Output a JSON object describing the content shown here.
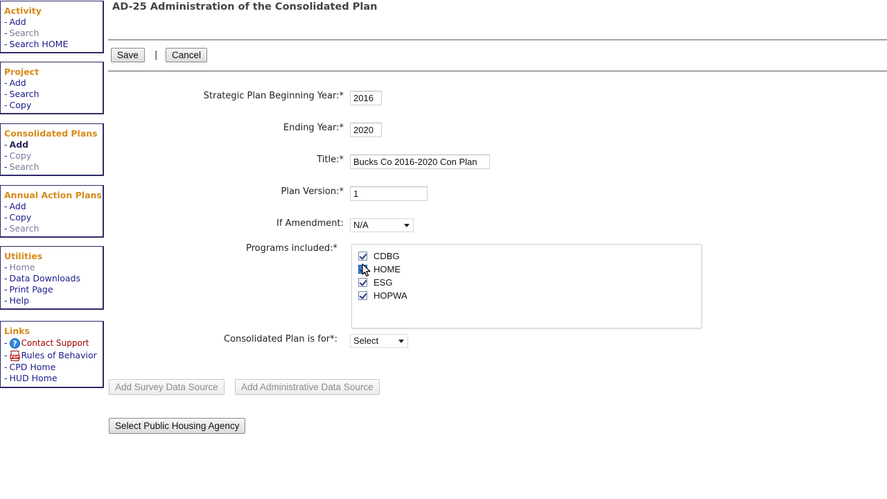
{
  "sidebar": {
    "activity": {
      "heading": "Activity",
      "items": [
        "Add",
        "Search",
        "Search HOME"
      ]
    },
    "project": {
      "heading": "Project",
      "items": [
        "Add",
        "Search",
        "Copy"
      ]
    },
    "consolidated": {
      "heading": "Consolidated Plans",
      "items": [
        "Add",
        "Copy",
        "Search"
      ]
    },
    "annual": {
      "heading": "Annual Action Plans",
      "items": [
        "Add",
        "Copy",
        "Search"
      ]
    },
    "utilities": {
      "heading": "Utilities",
      "items": [
        "Home",
        "Data Downloads",
        "Print Page",
        "Help"
      ]
    },
    "links": {
      "heading": "Links",
      "items": [
        "Contact Support",
        "Rules of Behavior",
        "CPD Home",
        "HUD Home"
      ],
      "icons": [
        "help-circle-icon",
        "pdf-icon"
      ]
    },
    "dash": "-"
  },
  "page": {
    "title": "AD-25 Administration of the Consolidated Plan"
  },
  "toolbar": {
    "save_label": "Save",
    "separator": "|",
    "cancel_label": "Cancel"
  },
  "form": {
    "begin_year": {
      "label": "Strategic Plan Beginning Year:*",
      "value": "2016"
    },
    "end_year": {
      "label": "Ending Year:*",
      "value": "2020"
    },
    "title": {
      "label": "Title:*",
      "value": "Bucks Co 2016-2020 Con Plan"
    },
    "plan_version": {
      "label": "Plan Version:*",
      "value": "1"
    },
    "amendment": {
      "label": "If Amendment:",
      "value": "N/A"
    },
    "programs": {
      "label": "Programs included:*",
      "items": [
        {
          "name": "CDBG",
          "checked": true
        },
        {
          "name": "HOME",
          "checked": true
        },
        {
          "name": "ESG",
          "checked": true
        },
        {
          "name": "HOPWA",
          "checked": true
        }
      ]
    },
    "plan_for": {
      "label": "Consolidated Plan is for*:",
      "value": "Select"
    }
  },
  "actions": {
    "add_survey": "Add Survey Data Source",
    "add_admin": "Add Administrative Data Source",
    "select_pha": "Select Public Housing Agency"
  },
  "colors": {
    "heading_orange": "#d68a1a",
    "link_blue": "#1a1a8c",
    "box_border": "#2b2b6b",
    "support_red": "#a00000"
  }
}
